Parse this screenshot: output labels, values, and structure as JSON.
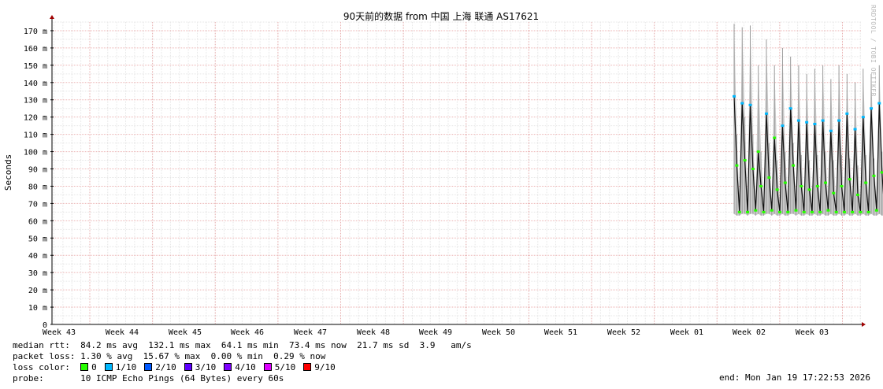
{
  "chart_data": {
    "type": "line",
    "title": "90天前的数据 from 中国 上海 联通 AS17621",
    "ylabel": "Seconds",
    "ylim": [
      0,
      175
    ],
    "y_ticks": [
      {
        "value": 0,
        "label": "0"
      },
      {
        "value": 10,
        "label": "10 m"
      },
      {
        "value": 20,
        "label": "20 m"
      },
      {
        "value": 30,
        "label": "30 m"
      },
      {
        "value": 40,
        "label": "40 m"
      },
      {
        "value": 50,
        "label": "50 m"
      },
      {
        "value": 60,
        "label": "60 m"
      },
      {
        "value": 70,
        "label": "70 m"
      },
      {
        "value": 80,
        "label": "80 m"
      },
      {
        "value": 90,
        "label": "90 m"
      },
      {
        "value": 100,
        "label": "100 m"
      },
      {
        "value": 110,
        "label": "110 m"
      },
      {
        "value": 120,
        "label": "120 m"
      },
      {
        "value": 130,
        "label": "130 m"
      },
      {
        "value": 140,
        "label": "140 m"
      },
      {
        "value": 150,
        "label": "150 m"
      },
      {
        "value": 160,
        "label": "160 m"
      },
      {
        "value": 170,
        "label": "170 m"
      }
    ],
    "x_weeks": [
      "Week 43",
      "Week 44",
      "Week 45",
      "Week 46",
      "Week 47",
      "Week 48",
      "Week 49",
      "Week 50",
      "Week 51",
      "Week 52",
      "Week 01",
      "Week 02",
      "Week 03"
    ],
    "grid": true,
    "series": [
      {
        "name": "median rtt",
        "x_days": [
          0.0,
          0.3,
          0.6,
          0.9,
          1.2,
          1.5,
          1.8,
          2.1,
          2.4,
          2.7,
          3.0,
          3.3,
          3.6,
          3.9,
          4.2,
          4.5,
          4.8,
          5.1,
          5.4,
          5.7,
          6.0,
          6.3,
          6.6,
          6.9,
          7.2,
          7.5,
          7.8,
          8.1,
          8.4,
          8.7,
          9.0,
          9.3,
          9.6,
          9.9,
          10.2,
          10.5,
          10.8,
          11.1,
          11.4,
          11.7,
          12.0,
          12.3,
          12.6,
          12.9,
          13.2,
          13.5,
          13.8,
          14.1,
          14.4,
          14.7,
          15.0,
          15.3,
          15.6,
          15.9,
          16.2,
          16.5,
          16.8,
          17.1,
          17.4,
          17.7,
          18.0,
          18.3,
          18.6,
          18.9,
          19.2,
          19.5
        ],
        "values": [
          132,
          92,
          65,
          128,
          95,
          65,
          127,
          90,
          66,
          100,
          80,
          65,
          122,
          85,
          66,
          108,
          78,
          65,
          115,
          82,
          65,
          125,
          92,
          66,
          118,
          80,
          65,
          117,
          78,
          65,
          116,
          80,
          65,
          118,
          82,
          66,
          112,
          76,
          65,
          118,
          80,
          65,
          122,
          84,
          65,
          113,
          75,
          65,
          120,
          82,
          65,
          125,
          86,
          66,
          128,
          88,
          65,
          120,
          80,
          66,
          112,
          76,
          65,
          116,
          78,
          73
        ]
      },
      {
        "name": "max",
        "values": [
          174,
          110,
          70,
          172,
          120,
          70,
          173,
          110,
          72,
          150,
          100,
          70,
          165,
          105,
          70,
          150,
          95,
          70,
          160,
          100,
          70,
          155,
          105,
          70,
          150,
          98,
          70,
          145,
          95,
          70,
          148,
          98,
          70,
          150,
          100,
          70,
          142,
          95,
          70,
          150,
          98,
          70,
          145,
          96,
          70,
          140,
          92,
          70,
          148,
          98,
          70,
          145,
          96,
          70,
          150,
          100,
          70,
          152,
          98,
          70,
          140,
          95,
          70,
          150,
          100,
          85
        ]
      },
      {
        "name": "min",
        "values": [
          64,
          63,
          63,
          64,
          64,
          63,
          64,
          64,
          63,
          64,
          63,
          63,
          64,
          64,
          63,
          64,
          63,
          63,
          64,
          63,
          63,
          64,
          64,
          63,
          64,
          63,
          63,
          64,
          63,
          63,
          64,
          63,
          63,
          64,
          63,
          63,
          64,
          63,
          63,
          64,
          63,
          63,
          64,
          63,
          63,
          64,
          63,
          63,
          64,
          63,
          63,
          64,
          63,
          63,
          64,
          63,
          63,
          64,
          63,
          63,
          64,
          63,
          63,
          64,
          63,
          65
        ]
      }
    ],
    "legend": {
      "median_rtt_label": "median rtt:",
      "median_rtt_values": "84.2 ms avg  132.1 ms max  64.1 ms min  73.4 ms now  21.7 ms sd  3.9   am/s",
      "packet_loss_label": "packet loss:",
      "packet_loss_values": "1.30 % avg  15.67 % max  0.00 % min  0.29 % now",
      "loss_color_label": "loss color:",
      "loss_colors": [
        {
          "label": "0",
          "color": "#26ff00"
        },
        {
          "label": "1/10",
          "color": "#00b8ff"
        },
        {
          "label": "2/10",
          "color": "#0059ff"
        },
        {
          "label": "3/10",
          "color": "#5e00ff"
        },
        {
          "label": "4/10",
          "color": "#7e00ff"
        },
        {
          "label": "5/10",
          "color": "#dd00ff"
        },
        {
          "label": "9/10",
          "color": "#ff0000"
        }
      ],
      "probe_label": "probe:",
      "probe_value": "10 ICMP Echo Pings (64 Bytes) every 60s"
    },
    "end_time": "end: Mon Jan 19 17:22:53 2026",
    "watermark": "RRDTOOL / TOBI OETIKER"
  }
}
